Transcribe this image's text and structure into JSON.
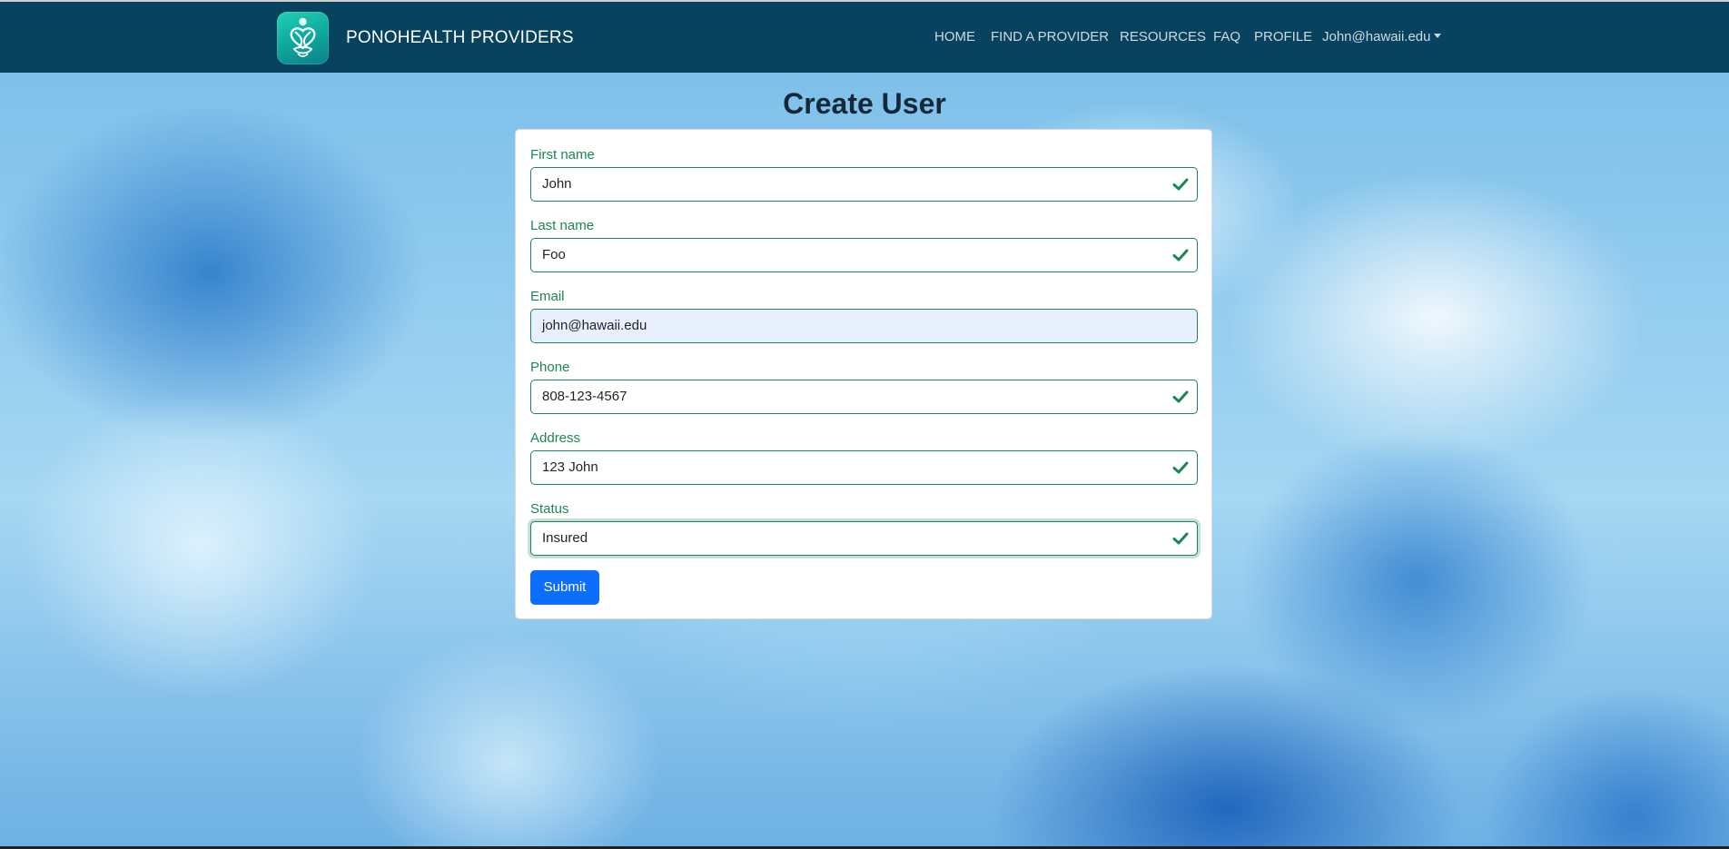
{
  "brand": {
    "name": "PONOHEALTH PROVIDERS",
    "logo_icon": "ponohealth-logo-icon",
    "logo_colors": [
      "#1fd1b4",
      "#0c7f88"
    ]
  },
  "nav": {
    "items": [
      {
        "label": "HOME"
      },
      {
        "label": "FIND A PROVIDER"
      },
      {
        "label": "RESOURCES"
      },
      {
        "label": "FAQ"
      },
      {
        "label": "PROFILE"
      }
    ],
    "user_menu": {
      "label": "John@hawaii.edu",
      "icon": "caret-down-icon"
    }
  },
  "page": {
    "title": "Create User"
  },
  "form": {
    "fields": [
      {
        "label": "First name",
        "value": "John",
        "valid": true
      },
      {
        "label": "Last name",
        "value": "Foo",
        "valid": true
      },
      {
        "label": "Email",
        "value": "john@hawaii.edu",
        "valid": false
      },
      {
        "label": "Phone",
        "value": "808-123-4567",
        "valid": true
      },
      {
        "label": "Address",
        "value": "123 John",
        "valid": true
      },
      {
        "label": "Status",
        "value": "Insured",
        "valid": true
      }
    ],
    "submit_label": "Submit"
  },
  "colors": {
    "navbar": "#07435f",
    "valid": "#198754",
    "primary": "#0d6efd",
    "autofill": "#e8f0fe"
  }
}
